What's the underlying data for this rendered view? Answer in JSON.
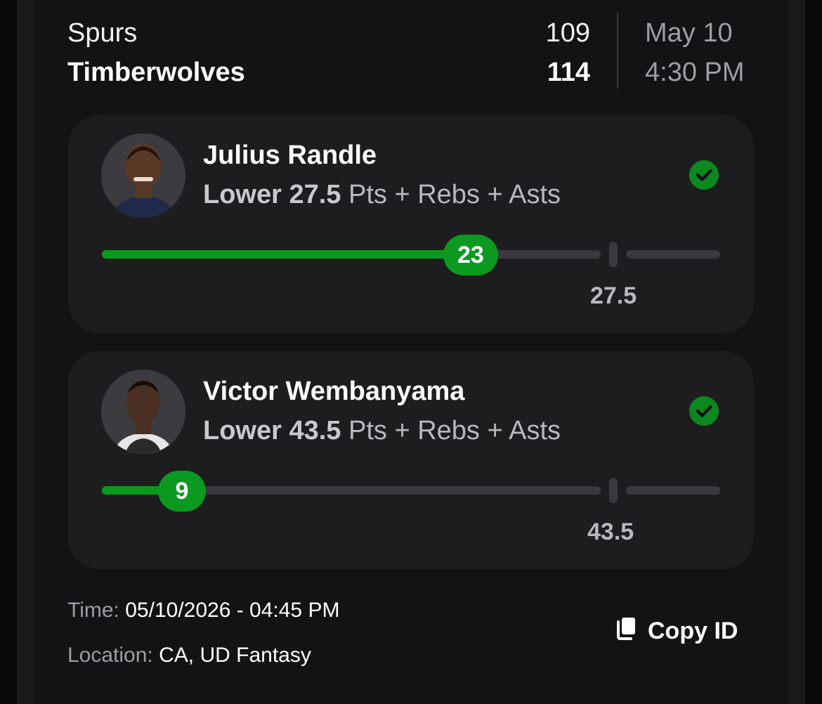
{
  "game": {
    "away_team": "Spurs",
    "away_score": "109",
    "home_team": "Timberwolves",
    "home_score": "114",
    "date": "May 10",
    "time": "4:30 PM"
  },
  "picks": [
    {
      "player": "Julius Randle",
      "direction": "Lower",
      "line": "27.5",
      "stat": "Pts + Rebs + Asts",
      "current": "23",
      "line_label": "27.5",
      "progress_fraction": 0.74,
      "status": "check-circle-icon",
      "avatar_icon": "player-photo"
    },
    {
      "player": "Victor Wembanyama",
      "direction": "Lower",
      "line": "43.5",
      "stat": "Pts + Rebs + Asts",
      "current": "9",
      "line_label": "43.5",
      "progress_fraction": 0.16,
      "status": "check-circle-icon",
      "avatar_icon": "player-photo"
    }
  ],
  "footer": {
    "time_label": "Time:",
    "time_value": "05/10/2026 - 04:45 PM",
    "location_label": "Location:",
    "location_value": "CA, UD Fantasy",
    "copy_label": "Copy ID"
  },
  "colors": {
    "accent_green": "#0b9a1f",
    "background": "#131315",
    "card": "#1d1d20",
    "muted_text": "#9d9da2"
  }
}
